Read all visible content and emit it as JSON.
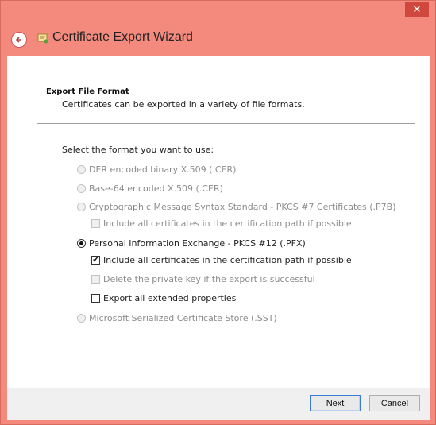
{
  "window": {
    "title": "Certificate Export Wizard",
    "close_glyph": "✕"
  },
  "section": {
    "title": "Export File Format",
    "subtitle": "Certificates can be exported in a variety of file formats."
  },
  "prompt": "Select the format you want to use:",
  "options": [
    {
      "label": "DER encoded binary X.509 (.CER)",
      "type": "radio",
      "enabled": false,
      "checked": false
    },
    {
      "label": "Base-64 encoded X.509 (.CER)",
      "type": "radio",
      "enabled": false,
      "checked": false
    },
    {
      "label": "Cryptographic Message Syntax Standard - PKCS #7 Certificates (.P7B)",
      "type": "radio",
      "enabled": false,
      "checked": false
    },
    {
      "label": "Include all certificates in the certification path if possible",
      "type": "checkbox",
      "enabled": false,
      "checked": false
    },
    {
      "label": "Personal Information Exchange - PKCS #12 (.PFX)",
      "type": "radio",
      "enabled": true,
      "checked": true
    },
    {
      "label": "Include all certificates in the certification path if possible",
      "type": "checkbox",
      "enabled": true,
      "checked": true
    },
    {
      "label": "Delete the private key if the export is successful",
      "type": "checkbox",
      "enabled": false,
      "checked": false
    },
    {
      "label": "Export all extended properties",
      "type": "checkbox",
      "enabled": true,
      "checked": false
    },
    {
      "label": "Microsoft Serialized Certificate Store (.SST)",
      "type": "radio",
      "enabled": false,
      "checked": false
    }
  ],
  "buttons": {
    "next": "Next",
    "cancel": "Cancel"
  },
  "icons": {
    "back": "back-arrow-icon",
    "wizard": "certificate-icon",
    "check_glyph": "✔"
  }
}
